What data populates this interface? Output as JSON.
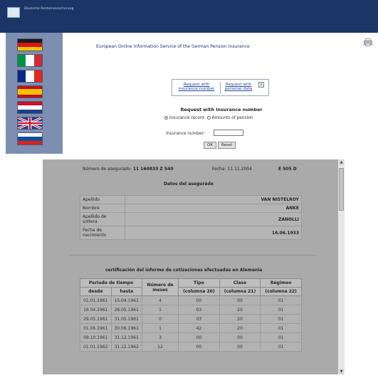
{
  "header": {
    "logo_text": "Deutsche Rentenversicherung"
  },
  "languages": [
    {
      "code": "de",
      "colors": [
        "#1a1a1a",
        "#d7141a",
        "#f4c400"
      ],
      "dir": "h"
    },
    {
      "code": "it",
      "colors": [
        "#009246",
        "#ffffff",
        "#ce2b37"
      ],
      "dir": "v"
    },
    {
      "code": "fr",
      "colors": [
        "#0b2a86",
        "#ffffff",
        "#e1261c"
      ],
      "dir": "v"
    },
    {
      "code": "es",
      "colors": [
        "#c60b1e",
        "#f4c300",
        "#c60b1e"
      ],
      "dir": "h3"
    },
    {
      "code": "nl",
      "colors": [
        "#c8102e",
        "#ffffff",
        "#1f3e8c"
      ],
      "dir": "h"
    },
    {
      "code": "uk",
      "colors": [
        "#1f3e8c",
        "#ffffff",
        "#cf142b"
      ],
      "dir": "uk"
    },
    {
      "code": "si",
      "colors": [
        "#ffffff",
        "#0e4ea1",
        "#d9241d"
      ],
      "dir": "h"
    }
  ],
  "page_title": "European Online Information Service of the German Pension Insurance",
  "request": {
    "by_number": "Request with insurance number",
    "by_personal": "Request with personal data",
    "help": "?"
  },
  "form": {
    "title": "Request with insurance number",
    "option_1": "Insurance record",
    "option_2": "Amounts of pension",
    "selected": "Insurance record",
    "number_label": "Insurance number:",
    "number_value": "",
    "ok": "OK",
    "reset": "Reset"
  },
  "document": {
    "numero_label": "Número de asegurado:",
    "numero_value": "11 160833 Z 540",
    "fecha_label": "Fecha:",
    "fecha_value": "11.11.2004",
    "form_code": "E 505 D",
    "datos_title": "Datos del asegurado",
    "datos": [
      {
        "label": "Apellido",
        "value": "VAN NISTELROY"
      },
      {
        "label": "Nombre",
        "value": "ANKE"
      },
      {
        "label": "Apellido de soltera",
        "value": "ZANOLLI"
      },
      {
        "label": "Fecha de nacimiento",
        "value": "16.06.1933"
      }
    ],
    "cert_title": "certificación del informe de cotizaciones efectuadas en Alemania",
    "cols": {
      "periodo": "Periodo de tiempo",
      "desde": "desde",
      "hasta": "hasta",
      "numero": "Número de meses",
      "meses": "meses",
      "tipo": "Tipo",
      "tipo_col": "(columna 20)",
      "clase": "Clase",
      "clase_col": "(columna 21)",
      "regimen": "Régimen",
      "regimen_col": "(columna 22)"
    },
    "rows": [
      [
        "01.01.1961",
        "15.04.1961",
        "4",
        "00",
        "00",
        "01"
      ],
      [
        "16.04.1961",
        "28.05.1961",
        "1",
        "03",
        "20",
        "01"
      ],
      [
        "29.05.1961",
        "31.05.1961",
        "0",
        "03",
        "20",
        "01"
      ],
      [
        "01.06.1961",
        "30.06.1961",
        "1",
        "42",
        "20",
        "01"
      ],
      [
        "09.10.1961",
        "31.12.1961",
        "3",
        "00",
        "00",
        "01"
      ],
      [
        "01.01.1962",
        "31.12.1962",
        "12",
        "00",
        "00",
        "01"
      ]
    ]
  }
}
